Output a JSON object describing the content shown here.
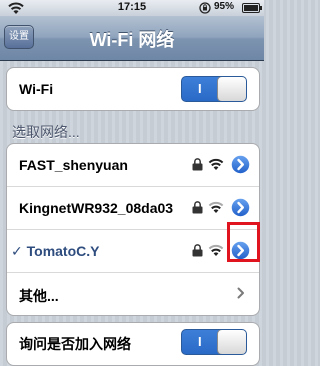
{
  "status_bar": {
    "time": "17:15",
    "battery": "95%"
  },
  "nav": {
    "back": "设置",
    "title": "Wi-Fi 网络"
  },
  "wifi_toggle": {
    "label": "Wi-Fi",
    "state": "I",
    "on": true
  },
  "section_header": "选取网络...",
  "networks": [
    {
      "name": "FAST_shenyuan",
      "locked": true,
      "selected": false
    },
    {
      "name": "KingnetWR932_08da03",
      "locked": true,
      "selected": false
    },
    {
      "name": "TomatoC.Y",
      "locked": true,
      "selected": true,
      "check": "✓"
    }
  ],
  "other": {
    "label": "其他..."
  },
  "ask_to_join": {
    "label": "询问是否加入网络",
    "state": "I",
    "on": true
  },
  "colors": {
    "accent_blue": "#2a6ac7",
    "highlight": "#e0141e"
  }
}
